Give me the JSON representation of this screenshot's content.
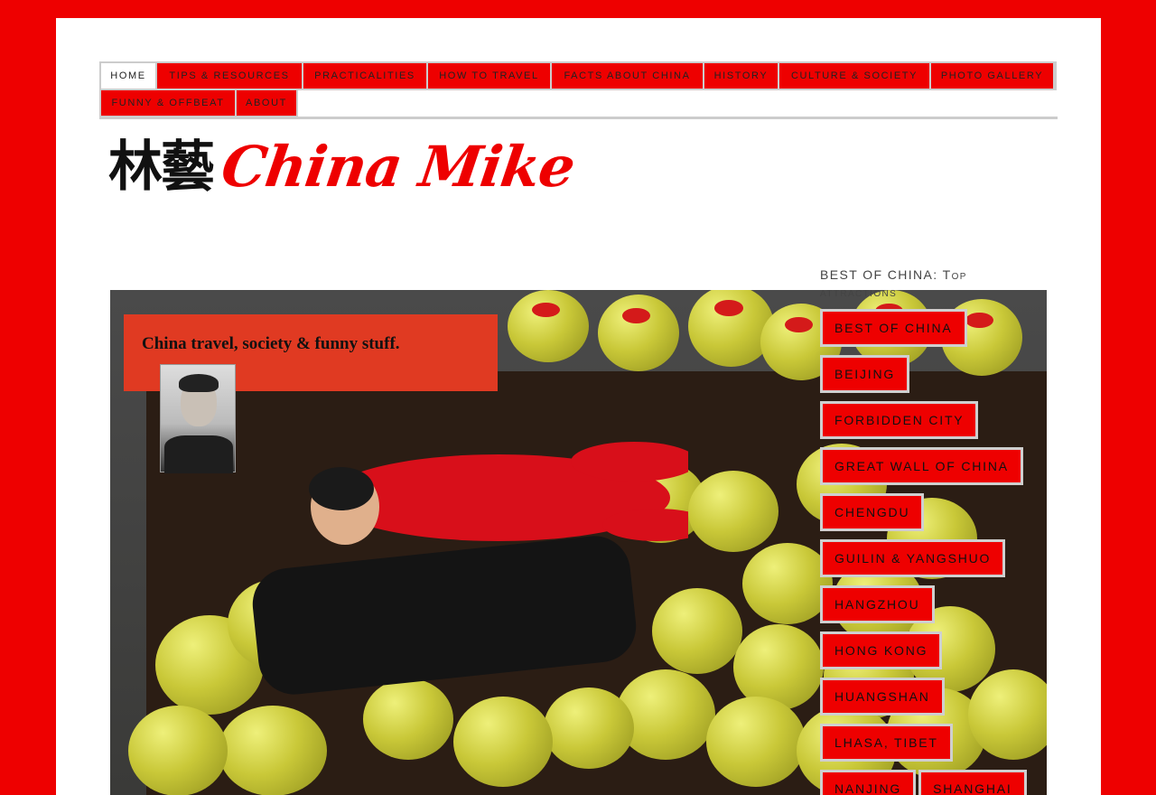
{
  "nav": {
    "row1": [
      "HOME",
      "TIPS & RESOURCES",
      "PRACTICALITIES",
      "HOW TO TRAVEL",
      "FACTS ABOUT CHINA",
      "HISTORY",
      "CULTURE & SOCIETY",
      "PHOTO GALLERY"
    ],
    "row2": [
      "FUNNY & OFFBEAT",
      "ABOUT"
    ],
    "active": "HOME"
  },
  "logo": {
    "chinese": "林藝",
    "latin": "China Mike"
  },
  "hero": {
    "banner_text": "China travel, society & funny stuff."
  },
  "sidebar": {
    "title_main": "BEST OF CHINA: T",
    "title_sc": "OP",
    "title_line2": "ATTRACTIONS",
    "tags": [
      "BEST OF CHINA",
      "BEIJING",
      "FORBIDDEN CITY",
      "GREAT WALL OF CHINA",
      "CHENGDU",
      "GUILIN & YANGSHUO",
      "HANGZHOU",
      "HONG KONG",
      "HUANGSHAN",
      "LHASA, TIBET",
      "NANJING",
      "SHANGHAI"
    ]
  },
  "colors": {
    "brand_red": "#ee0000",
    "border_gray": "#cccccc"
  }
}
